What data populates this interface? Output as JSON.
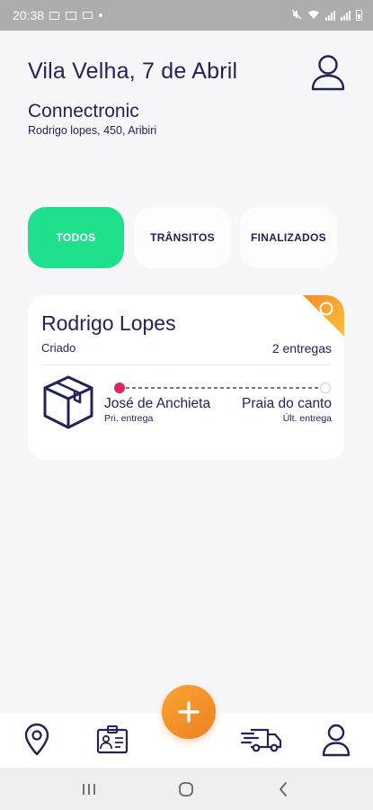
{
  "status_bar": {
    "time": "20:38",
    "icons": [
      "image-icon",
      "monitor-icon",
      "briefcase-icon",
      "dot-icon",
      "mute-icon",
      "wifi-icon",
      "signal-icon",
      "signal-icon",
      "battery-icon"
    ]
  },
  "header": {
    "date_title": "Vila Velha, 7 de Abril",
    "company_name": "Connectronic",
    "address": "Rodrigo lopes, 450, Aribiri"
  },
  "filters": {
    "tabs": [
      {
        "label": "TODOS",
        "active": true
      },
      {
        "label": "TRÂNSITOS",
        "active": false
      },
      {
        "label": "FINALIZADOS",
        "active": false
      }
    ]
  },
  "delivery_card": {
    "name": "Rodrigo Lopes",
    "status": "Criado",
    "count": "2 entregas",
    "first_place": "José de Anchieta",
    "first_label": "Pri. entrega",
    "last_place": "Praia do canto",
    "last_label": "Últ. entrega"
  },
  "bottom_nav": {
    "items": [
      "location-icon",
      "id-card-icon",
      "add-icon",
      "delivery-truck-icon",
      "user-icon"
    ]
  },
  "colors": {
    "accent_green": "#1fe08d",
    "primary_navy": "#23235a",
    "fab_orange": "#f39325",
    "start_dot": "#e0245e"
  }
}
